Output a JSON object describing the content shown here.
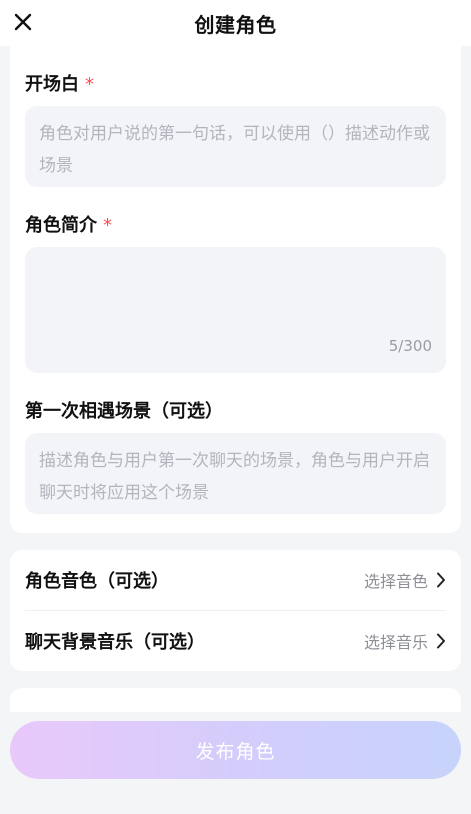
{
  "header": {
    "title": "创建角色",
    "close_icon": "close-icon"
  },
  "opening_line": {
    "label": "开场白",
    "required_mark": "*",
    "placeholder": "角色对用户说的第一句话，可以使用（）描述动作或场景"
  },
  "intro": {
    "label": "角色简介",
    "required_mark": "*",
    "value": "",
    "counter": "5/300"
  },
  "first_scene": {
    "label": "第一次相遇场景（可选）",
    "placeholder": "描述角色与用户第一次聊天的场景，角色与用户开启聊天时将应用这个场景"
  },
  "options": [
    {
      "label": "角色音色（可选）",
      "action": "选择音色"
    },
    {
      "label": "聊天背景音乐（可选）",
      "action": "选择音乐"
    }
  ],
  "partial_section": {
    "label": "…"
  },
  "publish_button": {
    "label": "发布角色"
  },
  "colors": {
    "required": "#ff4d4f",
    "placeholder": "#b3b5bd",
    "button_gradient_start": "#e9c8fb",
    "button_gradient_end": "#c7d3fb"
  }
}
